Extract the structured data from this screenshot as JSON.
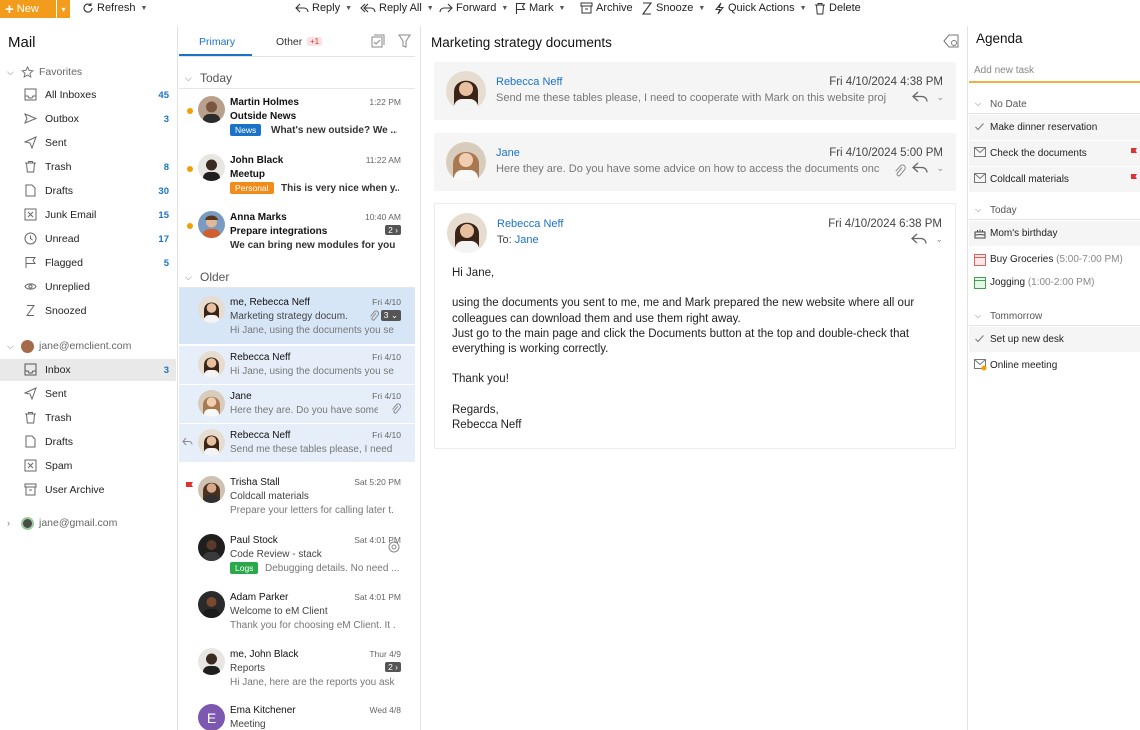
{
  "toolbar": {
    "new_label": "New",
    "refresh_label": "Refresh",
    "reply_label": "Reply",
    "reply_all_label": "Reply All",
    "forward_label": "Forward",
    "mark_label": "Mark",
    "archive_label": "Archive",
    "snooze_label": "Snooze",
    "quick_actions_label": "Quick Actions",
    "delete_label": "Delete"
  },
  "sidebar": {
    "title": "Mail",
    "favorites_label": "Favorites",
    "favorites": [
      {
        "label": "All Inboxes",
        "count": "45"
      },
      {
        "label": "Outbox",
        "count": "3"
      },
      {
        "label": "Sent",
        "count": ""
      },
      {
        "label": "Trash",
        "count": "8"
      },
      {
        "label": "Drafts",
        "count": "30"
      },
      {
        "label": "Junk Email",
        "count": "15"
      },
      {
        "label": "Unread",
        "count": "17"
      },
      {
        "label": "Flagged",
        "count": "5"
      },
      {
        "label": "Unreplied",
        "count": ""
      },
      {
        "label": "Snoozed",
        "count": ""
      }
    ],
    "account1": "jane@emclient.com",
    "account1_folders": [
      {
        "label": "Inbox",
        "count": "3"
      },
      {
        "label": "Sent",
        "count": ""
      },
      {
        "label": "Trash",
        "count": ""
      },
      {
        "label": "Drafts",
        "count": ""
      },
      {
        "label": "Spam",
        "count": ""
      },
      {
        "label": "User Archive",
        "count": ""
      }
    ],
    "account2": "jane@gmail.com"
  },
  "msglist": {
    "tab_primary": "Primary",
    "tab_other": "Other",
    "tab_other_badge": "+1",
    "section_today": "Today",
    "section_older": "Older",
    "today": [
      {
        "from": "Martin Holmes",
        "time": "1:22 PM",
        "subject": "Outside News",
        "tag": "News",
        "preview": "What's new outside? We ..."
      },
      {
        "from": "John Black",
        "time": "11:22 AM",
        "subject": "Meetup",
        "tag": "Personal",
        "preview": "This is very nice when y..."
      },
      {
        "from": "Anna Marks",
        "time": "10:40 AM",
        "subject": "Prepare integrations",
        "count": "2",
        "preview": "We can bring new modules for you..."
      }
    ],
    "older": [
      {
        "from": "me, Rebecca Neff",
        "time": "Fri 4/10",
        "subject": "Marketing strategy docum...",
        "count": "3",
        "preview": "Hi Jane, using the documents you se..."
      },
      {
        "from": "Rebecca Neff",
        "time": "Fri 4/10",
        "preview": "Hi Jane, using the documents you se..."
      },
      {
        "from": "Jane",
        "time": "Fri 4/10",
        "preview": "Here they are. Do you have some..."
      },
      {
        "from": "Rebecca Neff",
        "time": "Fri 4/10",
        "preview": "Send me these tables please, I need t..."
      },
      {
        "from": "Trisha Stall",
        "time": "Sat 5:20 PM",
        "subject": "Coldcall materials",
        "preview": "Prepare your letters for calling later t..."
      },
      {
        "from": "Paul Stock",
        "time": "Sat 4:01 PM",
        "subject": "Code Review - stack",
        "tag": "Logs",
        "preview": "Debugging details. No need ..."
      },
      {
        "from": "Adam Parker",
        "time": "Sat 4:01 PM",
        "subject": "Welcome to eM Client",
        "preview": "Thank you for choosing eM Client. It ..."
      },
      {
        "from": "me, John Black",
        "time": "Thur 4/9",
        "subject": "Reports",
        "count": "2",
        "preview": "Hi Jane, here are the reports you ask..."
      },
      {
        "from": "Ema Kitchener",
        "time": "Wed 4/8",
        "subject": "Meeting",
        "initial": "E"
      }
    ]
  },
  "reading": {
    "title": "Marketing strategy documents",
    "messages": [
      {
        "sender": "Rebecca Neff",
        "date": "Fri 4/10/2024 4:38 PM",
        "preview": "Send me these tables please, I need to cooperate with Mark on this website project..."
      },
      {
        "sender": "Jane",
        "date": "Fri 4/10/2024 5:00 PM",
        "preview": "Here they are. Do you have some advice on how to access the documents once th..."
      },
      {
        "sender": "Rebecca Neff",
        "date": "Fri 4/10/2024 6:38 PM",
        "to_label": "To:",
        "to": "Jane"
      }
    ],
    "body": {
      "greeting": "Hi Jane,",
      "line1": "using the documents you sent to me, me and Mark prepared the new website where all our",
      "line2": "colleagues can download them and use them right away.",
      "line3": "Just go to the main page and click the Documents button at the top and double-check that",
      "line4": "everything is working correctly.",
      "thanks": "Thank you!",
      "regards": "Regards,",
      "signature": "Rebecca Neff"
    }
  },
  "agenda": {
    "title": "Agenda",
    "add_placeholder": "Add new task",
    "no_date_label": "No Date",
    "no_date": [
      "Make dinner reservation",
      "Check the documents",
      "Coldcall materials"
    ],
    "today_label": "Today",
    "today": [
      {
        "label": "Mom's birthday",
        "time": ""
      },
      {
        "label": "Buy Groceries",
        "time": "(5:00-7:00 PM)"
      },
      {
        "label": "Jogging",
        "time": "(1:00-2:00 PM)"
      }
    ],
    "tomorrow_label": "Tommorrow",
    "tomorrow": [
      "Set up new desk",
      "Online meeting"
    ]
  },
  "colors": {
    "accent": "#1a73c8",
    "new_button": "#f39c1b",
    "tag_news": "#1a73c8",
    "tag_personal": "#f08c1a",
    "tag_logs": "#2aa84a",
    "flag": "#e03030"
  }
}
